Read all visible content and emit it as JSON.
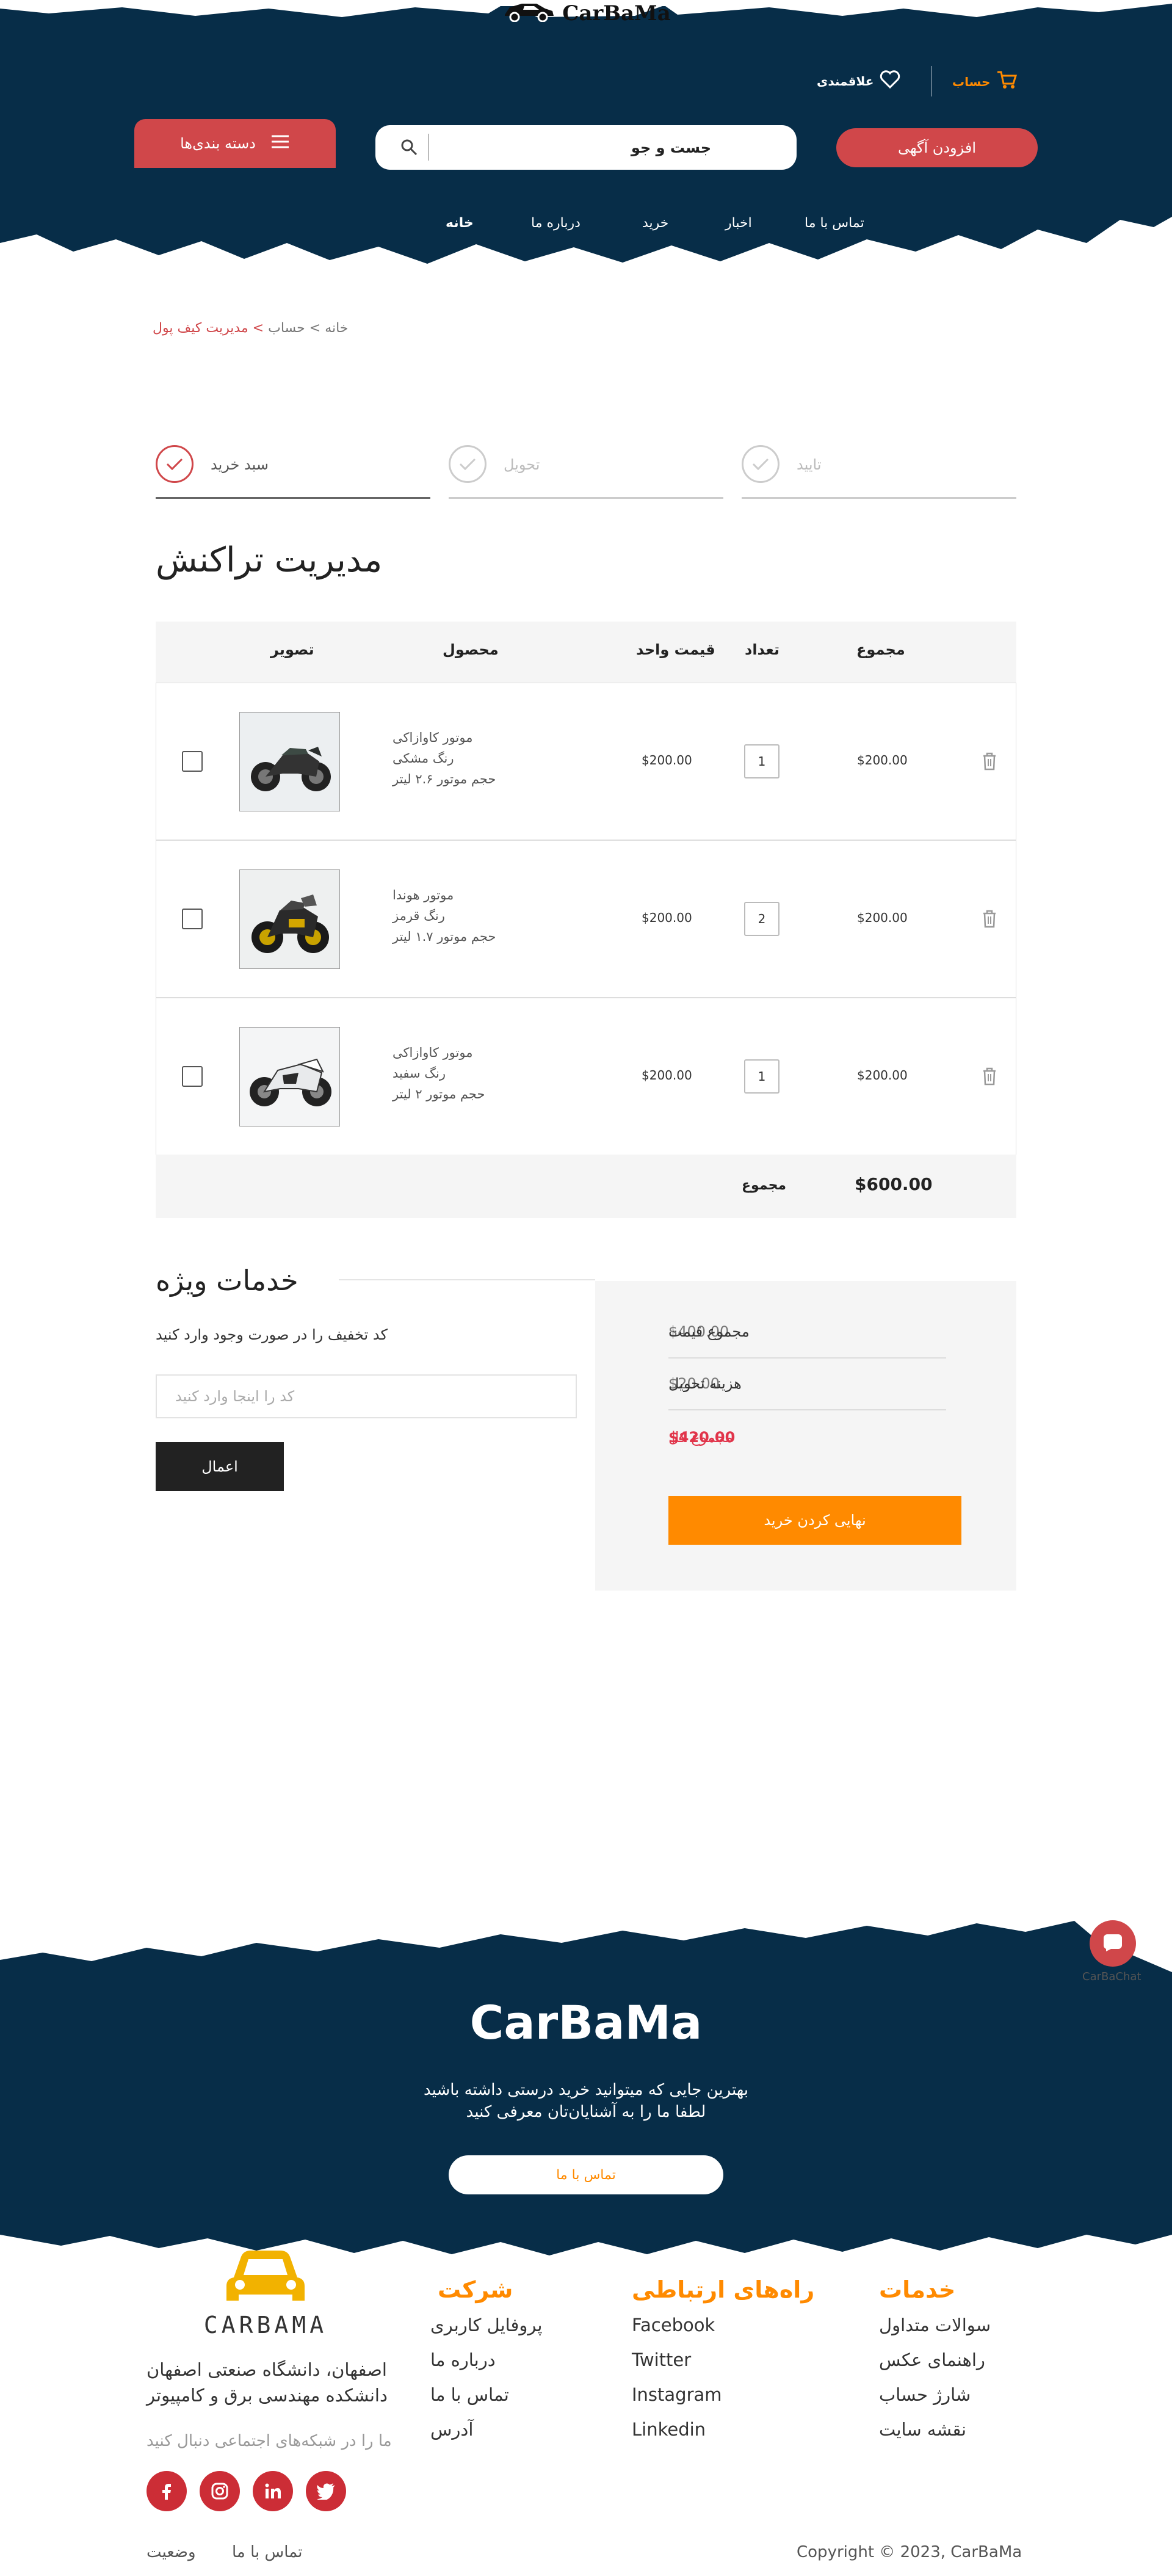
{
  "header": {
    "brand": "CarBaMa",
    "account_label": "حساب",
    "favorites_label": "علاقمندی",
    "add_ad_label": "افزودن آگهی",
    "categories_label": "دسته بندی‌ها",
    "search_placeholder": "جست و جو",
    "nav": [
      "خانه",
      "درباره ما",
      "خرید",
      "اخبار",
      "تماس با ما"
    ]
  },
  "breadcrumb": {
    "home": "خانه",
    "sep1": ">",
    "account": "حساب",
    "sep2": ">",
    "current": "مدیریت کیف پول"
  },
  "steps": [
    {
      "label": "سبد خرید",
      "active": true
    },
    {
      "label": "تحویل",
      "active": false
    },
    {
      "label": "تایید",
      "active": false
    }
  ],
  "page_title": "مدیریت تراکنش",
  "table": {
    "headers": {
      "image": "تصویر",
      "product": "محصول",
      "unit_price": "قیمت واحد",
      "quantity": "تعداد",
      "total": "مجموع"
    },
    "rows": [
      {
        "line1": "موتور کاوازاکی",
        "line2": "رنگ مشکی",
        "line3": "حجم موتور ۲.۶ لیتر",
        "price": "$200.00",
        "qty": "1",
        "total": "$200.00"
      },
      {
        "line1": "موتور هوندا",
        "line2": "رنگ قرمز",
        "line3": "حجم موتور ۱.۷ لیتر",
        "price": "$200.00",
        "qty": "2",
        "total": "$200.00"
      },
      {
        "line1": "موتور کاوازاکی",
        "line2": "رنگ سفید",
        "line3": "حجم موتور ۲ لیتر",
        "price": "$200.00",
        "qty": "1",
        "total": "$200.00"
      }
    ],
    "footer_label": "مجموع",
    "footer_total": "$600.00"
  },
  "special": {
    "title": "خدمات ویژه",
    "coupon_label": "کد تخفیف را در صورت وجود وارد کنید",
    "coupon_placeholder": "کد را اینجا وارد کنید",
    "apply_label": "اعمال"
  },
  "summary": {
    "subtotal_label": "مجموع قیمت",
    "subtotal_value": "$400.00",
    "delivery_label": "هزینه تحویل",
    "delivery_value": "$20.00",
    "total_label": "مجموع کل",
    "total_value": "$420.00",
    "checkout_label": "نهایی کردن خرید"
  },
  "chat": {
    "label": "CarBaChat"
  },
  "footer": {
    "brand": "CarBaMa",
    "tagline1": "بهترین جایی که میتوانید خرید درستی داشته باشید",
    "tagline2": "لطفا ما را به آشنایان‌تان معرفی کنید",
    "contact_btn": "تماس با ما",
    "logo_text": "CARBAMA",
    "address1": "اصفهان، دانشگاه صنعتی اصفهان",
    "address2": "دانشکده مهندسی برق و کامپیوتر",
    "follow_text": "ما را در شبکه‌های اجتماعی دنبال کنید",
    "columns": {
      "services": {
        "title": "خدمات",
        "items": [
          "سوالات متداول",
          "راهنمای عکس",
          "شارژ حساب",
          "نقشه سایت"
        ]
      },
      "contact": {
        "title": "راه‌های ارتباطی",
        "items": [
          "Facebook",
          "Twitter",
          "Instagram",
          "Linkedin"
        ]
      },
      "company": {
        "title": "شرکت",
        "items": [
          "پروفایل کاربری",
          "درباره ما",
          "تماس با ما",
          "آدرس"
        ]
      }
    },
    "bottom_links": [
      "تماس با ما",
      "وضعیت"
    ],
    "copyright": "Copyright © 2023, CarBaMa"
  },
  "colors": {
    "navy": "#072d48",
    "red": "#d0474a",
    "orange": "#ff8a00",
    "social": "#cc2d36"
  },
  "icons": [
    "cart-icon",
    "heart-icon",
    "search-icon",
    "hamburger-icon",
    "check-icon",
    "trash-icon",
    "chat-icon",
    "facebook-icon",
    "instagram-icon",
    "linkedin-icon",
    "twitter-icon"
  ]
}
